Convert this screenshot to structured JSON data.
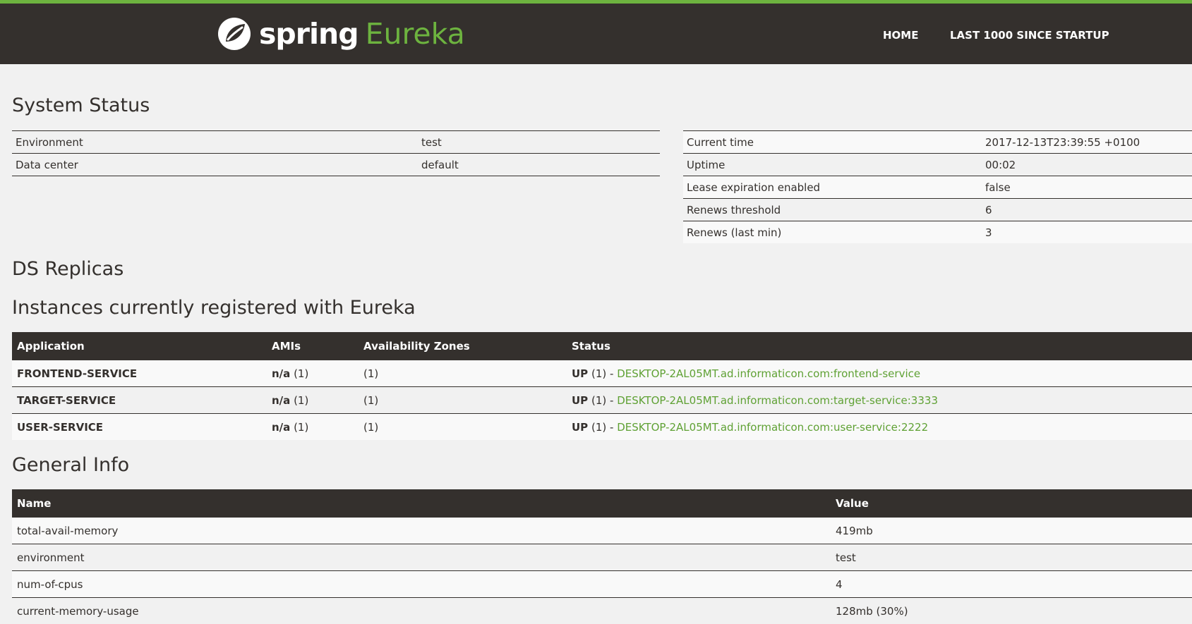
{
  "nav": {
    "brand_spring": "spring",
    "brand_eureka": "Eureka",
    "home": "HOME",
    "last1000": "LAST 1000 SINCE STARTUP"
  },
  "system_status": {
    "title": "System Status",
    "left": [
      {
        "label": "Environment",
        "value": "test"
      },
      {
        "label": "Data center",
        "value": "default"
      }
    ],
    "right": [
      {
        "label": "Current time",
        "value": "2017-12-13T23:39:55 +0100"
      },
      {
        "label": "Uptime",
        "value": "00:02"
      },
      {
        "label": "Lease expiration enabled",
        "value": "false"
      },
      {
        "label": "Renews threshold",
        "value": "6"
      },
      {
        "label": "Renews (last min)",
        "value": "3"
      }
    ]
  },
  "ds_replicas": {
    "title": "DS Replicas"
  },
  "instances": {
    "title": "Instances currently registered with Eureka",
    "headers": [
      "Application",
      "AMIs",
      "Availability Zones",
      "Status"
    ],
    "rows": [
      {
        "application": "FRONTEND-SERVICE",
        "ami": "n/a",
        "ami_count": "(1)",
        "zones": "(1)",
        "status": "UP",
        "status_count": "(1) -",
        "link": "DESKTOP-2AL05MT.ad.informaticon.com:frontend-service"
      },
      {
        "application": "TARGET-SERVICE",
        "ami": "n/a",
        "ami_count": "(1)",
        "zones": "(1)",
        "status": "UP",
        "status_count": "(1) -",
        "link": "DESKTOP-2AL05MT.ad.informaticon.com:target-service:3333"
      },
      {
        "application": "USER-SERVICE",
        "ami": "n/a",
        "ami_count": "(1)",
        "zones": "(1)",
        "status": "UP",
        "status_count": "(1) -",
        "link": "DESKTOP-2AL05MT.ad.informaticon.com:user-service:2222"
      }
    ]
  },
  "general_info": {
    "title": "General Info",
    "headers": [
      "Name",
      "Value"
    ],
    "rows": [
      {
        "name": "total-avail-memory",
        "value": "419mb"
      },
      {
        "name": "environment",
        "value": "test"
      },
      {
        "name": "num-of-cpus",
        "value": "4"
      },
      {
        "name": "current-memory-usage",
        "value": "128mb (30%)"
      }
    ]
  },
  "colors": {
    "dark": "#34302d",
    "accent": "#6db33f",
    "link": "#5fa134",
    "background": "#f1f1f1"
  }
}
